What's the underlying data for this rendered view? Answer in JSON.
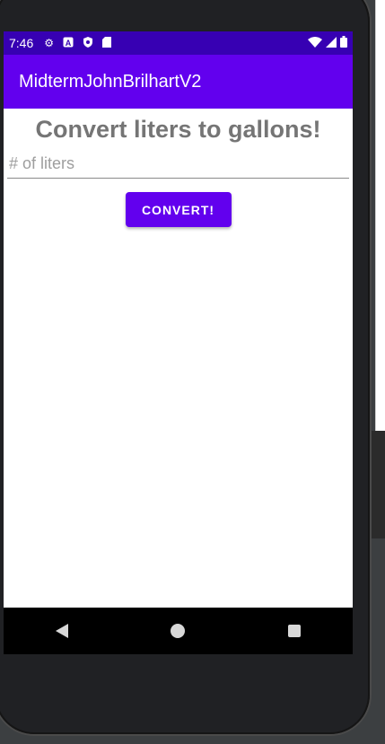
{
  "status_bar": {
    "time": "7:46",
    "icons": [
      "settings-icon",
      "a-icon",
      "shield-icon",
      "sd-card-icon"
    ],
    "right_icons": [
      "wifi-icon",
      "signal-icon",
      "battery-icon"
    ]
  },
  "app_bar": {
    "title": "MidtermJohnBrilhartV2"
  },
  "main": {
    "heading": "Convert liters to gallons!",
    "liters_input": {
      "value": "",
      "placeholder": "# of liters"
    },
    "convert_button_label": "CONVERT!"
  },
  "nav_bar": {
    "buttons": [
      "back-icon",
      "home-icon",
      "recents-icon"
    ]
  },
  "colors": {
    "primary": "#6200ee",
    "primary_dark": "#3700b3",
    "heading_text": "#757575"
  }
}
